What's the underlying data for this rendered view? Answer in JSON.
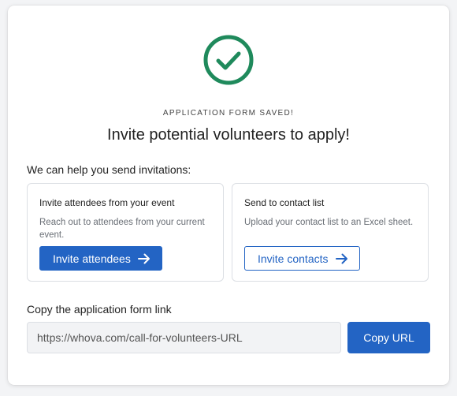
{
  "status": {
    "icon": "check-circle-icon",
    "eyebrow": "APPLICATION FORM SAVED!",
    "headline": "Invite potential volunteers to apply!"
  },
  "invitations": {
    "label": "We can help you send invitations:",
    "options": [
      {
        "title": "Invite attendees from your event",
        "description": "Reach out to attendees from your current event.",
        "button_label": "Invite attendees",
        "button_icon": "arrow-right-icon"
      },
      {
        "title": "Send to contact list",
        "description": "Upload your contact list to an Excel sheet.",
        "button_label": "Invite contacts",
        "button_icon": "arrow-right-icon"
      }
    ]
  },
  "link": {
    "label": "Copy the application form link",
    "url": "https://whova.com/call-for-volunteers-URL",
    "copy_label": "Copy URL"
  },
  "colors": {
    "success": "#1f8a5c",
    "accent": "#2364c4"
  }
}
